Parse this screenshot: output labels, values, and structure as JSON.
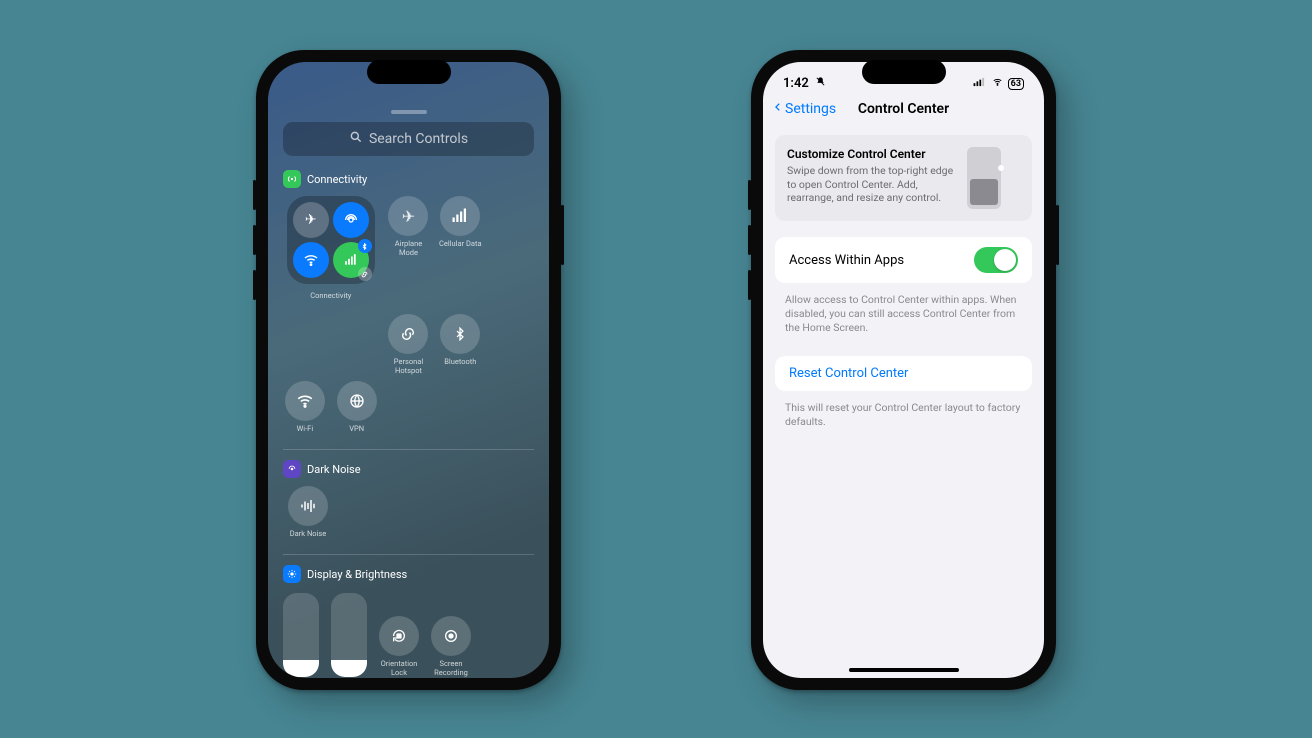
{
  "left": {
    "search_placeholder": "Search Controls",
    "sections": {
      "connectivity": {
        "title": "Connectivity",
        "tiles": {
          "connectivity_cluster": "Connectivity",
          "airplane": "Airplane Mode",
          "cellular": "Cellular Data",
          "hotspot": "Personal\nHotspot",
          "bluetooth": "Bluetooth",
          "wifi": "Wi-Fi",
          "vpn": "VPN"
        }
      },
      "darknoise": {
        "title": "Dark Noise",
        "tile": "Dark Noise"
      },
      "display": {
        "title": "Display & Brightness",
        "tiles": {
          "orientation": "Orientation\nLock",
          "recording": "Screen\nRecording"
        }
      }
    }
  },
  "right": {
    "status": {
      "time": "1:42",
      "battery": "63"
    },
    "nav": {
      "back": "Settings",
      "title": "Control Center"
    },
    "hero": {
      "title": "Customize Control Center",
      "body": "Swipe down from the top-right edge to open Control Center. Add, rearrange, and resize any control."
    },
    "access": {
      "label": "Access Within Apps",
      "note": "Allow access to Control Center within apps. When disabled, you can still access Control Center from the Home Screen."
    },
    "reset": {
      "label": "Reset Control Center",
      "note": "This will reset your Control Center layout to factory defaults."
    }
  }
}
